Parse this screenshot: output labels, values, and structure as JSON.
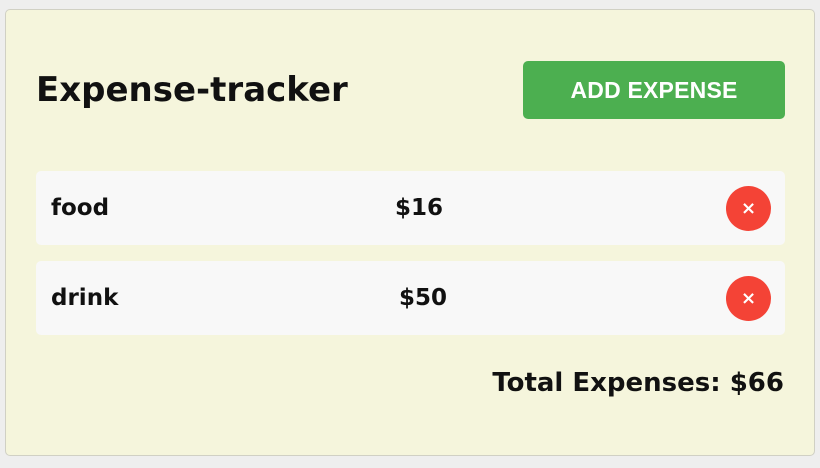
{
  "header": {
    "title": "Expense-tracker",
    "add_button_label": "ADD EXPENSE"
  },
  "expenses": [
    {
      "name": "food",
      "amount": "$16",
      "delete_icon": "×"
    },
    {
      "name": "drink",
      "amount": "$50",
      "delete_icon": "×"
    }
  ],
  "summary": {
    "total_text": "Total Expenses: $66"
  },
  "colors": {
    "card_background": "#f5f5dc",
    "row_background": "#f8f8f8",
    "add_button": "#4caf50",
    "delete_button": "#f44336"
  },
  "icons": {
    "delete": "close-icon"
  }
}
